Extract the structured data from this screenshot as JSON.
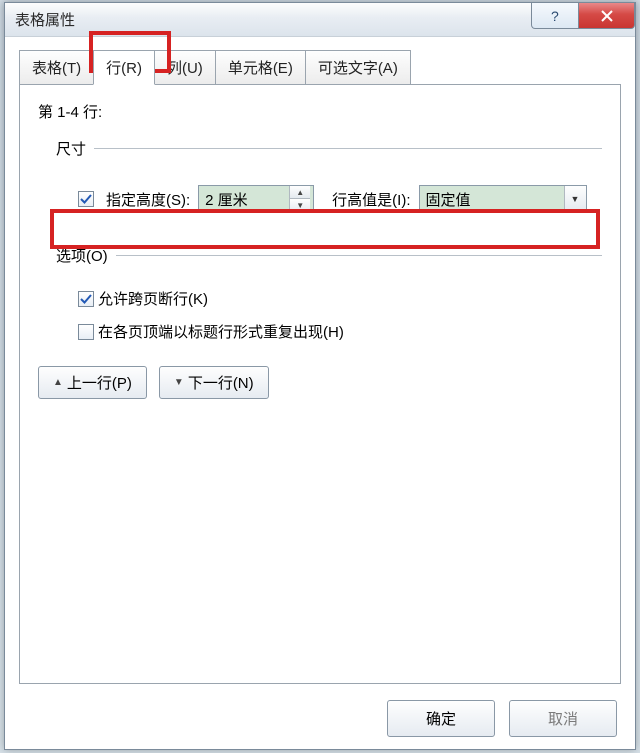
{
  "title": "表格属性",
  "tabs": {
    "table": "表格(T)",
    "row": "行(R)",
    "column": "列(U)",
    "cell": "单元格(E)",
    "alttext": "可选文字(A)"
  },
  "rows_heading": "第 1-4 行:",
  "size_section": "尺寸",
  "specify_height": {
    "checked": true,
    "label": "指定高度(S):",
    "value": "2 厘米"
  },
  "row_height_label": "行高值是(I):",
  "row_height_value": "固定值",
  "options_section": "选项(O)",
  "opt_break": {
    "checked": true,
    "label": "允许跨页断行(K)"
  },
  "opt_repeat": {
    "checked": false,
    "label": "在各页顶端以标题行形式重复出现(H)"
  },
  "prev_row": "上一行(P)",
  "next_row": "下一行(N)",
  "ok": "确定",
  "cancel": "取消"
}
